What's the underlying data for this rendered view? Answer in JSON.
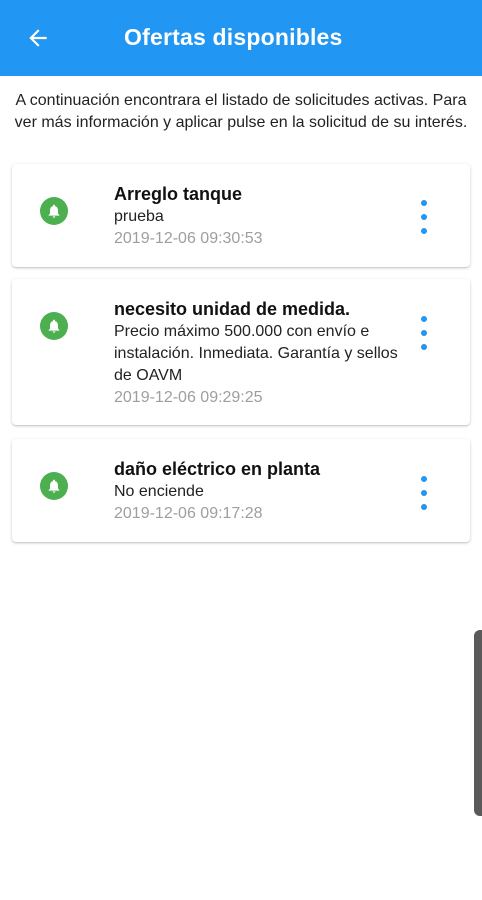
{
  "header": {
    "title": "Ofertas disponibles",
    "back_icon": "arrow-left-icon",
    "background": "#2196f3"
  },
  "intro_text": "A continuación encontrara el listado de solicitudes activas. Para ver más información y aplicar pulse en la solicitud de su interés.",
  "offers": [
    {
      "title": "Arreglo tanque",
      "description": "prueba",
      "date": "2019-12-06 09:30:53",
      "icon": "bell-icon"
    },
    {
      "title": "necesito unidad de medida.",
      "description": "Precio máximo 500.000 con envío e instalación. Inmediata. Garantía y sellos de OAVM",
      "date": "2019-12-06 09:29:25",
      "icon": "bell-icon"
    },
    {
      "title": "daño eléctrico en planta",
      "description": "No enciende",
      "date": "2019-12-06 09:17:28",
      "icon": "bell-icon"
    }
  ],
  "colors": {
    "accent": "#2196f3",
    "status_icon": "#4caf50",
    "date_text": "#9e9e9e"
  }
}
